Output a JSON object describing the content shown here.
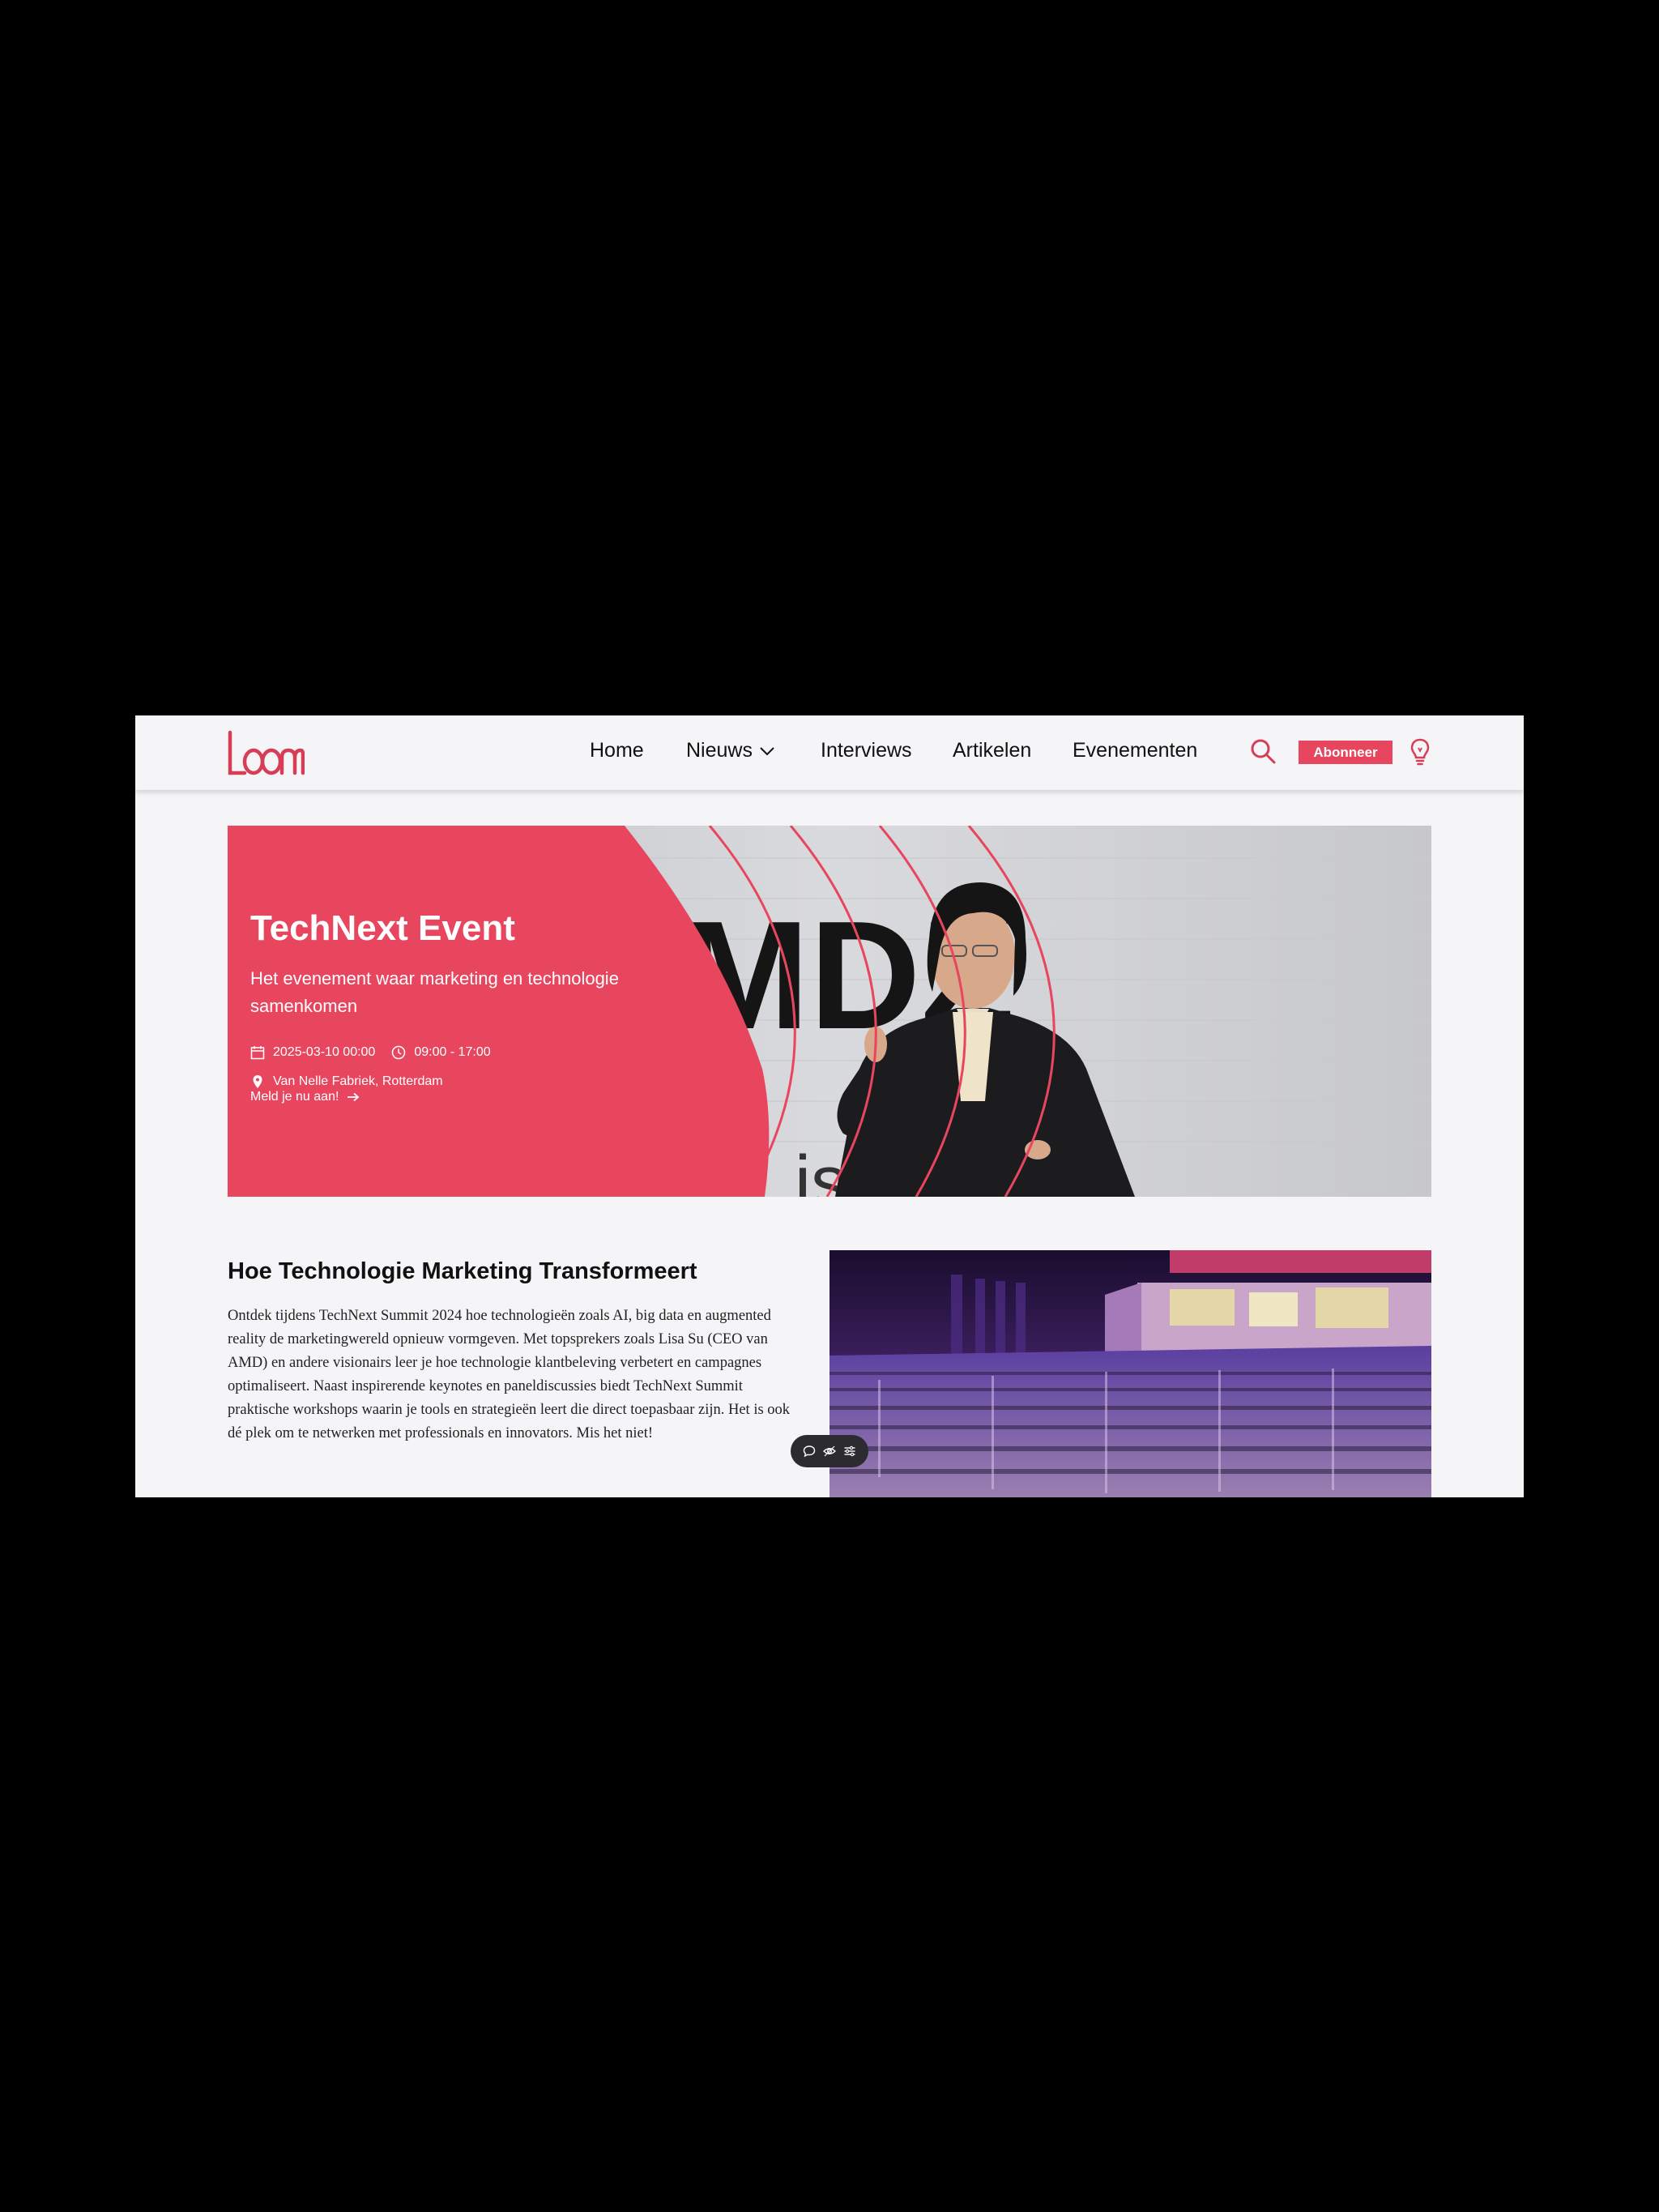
{
  "header": {
    "logo_alt": "Loom",
    "nav": [
      {
        "label": "Home"
      },
      {
        "label": "Nieuws"
      },
      {
        "label": "Interviews"
      },
      {
        "label": "Artikelen"
      },
      {
        "label": "Evenementen"
      }
    ],
    "subscribe_label": "Abonneer",
    "icons": [
      "search-icon",
      "chevron-down-icon",
      "lightbulb-icon"
    ]
  },
  "hero": {
    "title": "TechNext Event",
    "subtitle": "Het evenement waar marketing en technologie samenkomen",
    "date": "2025-03-10 00:00",
    "time": "09:00 - 17:00",
    "location": "Van Nelle Fabriek, Rotterdam",
    "cta": "Meld je nu aan!",
    "backdrop_letters": "MDZ",
    "backdrop_letters_bottom": "isa"
  },
  "article": {
    "title": "Hoe Technologie Marketing Transformeert",
    "body": "Ontdek tijdens TechNext Summit 2024 hoe technologieën zoals AI, big data en augmented reality de marketingwereld opnieuw vormgeven. Met topsprekers zoals Lisa Su (CEO van AMD) en andere visionairs leer je hoe technologie klantbeleving verbetert en campagnes optimaliseert. Naast inspirerende keynotes en paneldiscussies biedt TechNext Summit praktische workshops waarin je tools en strategieën leert die direct toepasbaar zijn. Het is ook dé plek om te netwerken met professionals en innovators. Mis het niet!"
  },
  "toolbar": {
    "icons": [
      "comment-icon",
      "eye-icon",
      "settings-sliders-icon"
    ]
  },
  "colors": {
    "accent": "#e8465f",
    "page_bg": "#f5f4f7",
    "outer_bg": "#000000"
  }
}
